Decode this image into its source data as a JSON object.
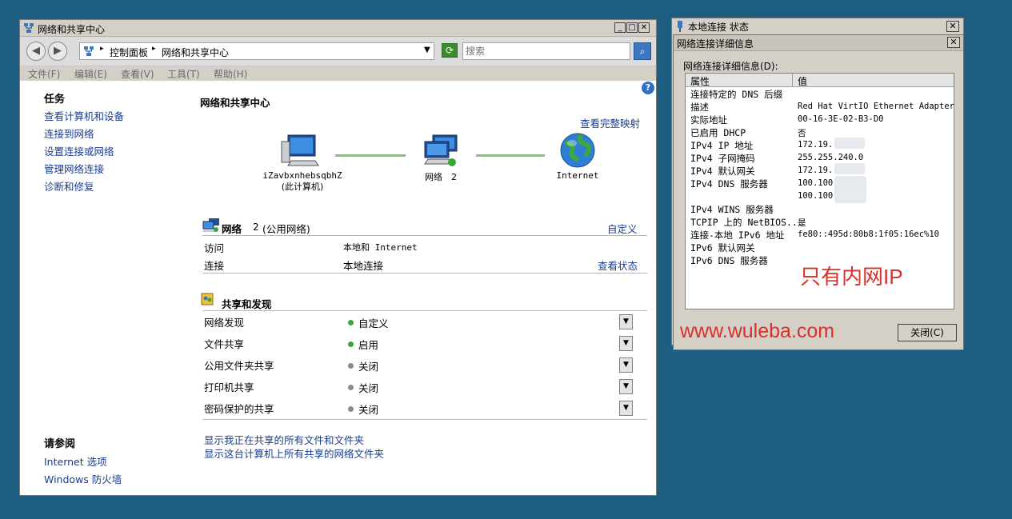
{
  "main_window": {
    "title": "网络和共享中心",
    "breadcrumb": [
      "控制面板",
      "网络和共享中心"
    ],
    "search_placeholder": "搜索",
    "menu": [
      "文件(F)",
      "编辑(E)",
      "查看(V)",
      "工具(T)",
      "帮助(H)"
    ],
    "tasks_title": "任务",
    "tasks": [
      "查看计算机和设备",
      "连接到网络",
      "设置连接或网络",
      "管理网络连接",
      "诊断和修复"
    ],
    "see_also_title": "请参阅",
    "see_also": [
      "Internet 选项",
      "Windows 防火墙"
    ],
    "heading": "网络和共享中心",
    "view_full_map": "查看完整映射",
    "map": {
      "computer_name": "iZavbxnhebsqbhZ",
      "computer_sub": "(此计算机)",
      "network": "网络　2",
      "internet": "Internet"
    },
    "network_section": {
      "name": "网络",
      "number": "2",
      "type": "(公用网络)",
      "customize": "自定义",
      "rows": [
        {
          "label": "访问",
          "value": "本地和 Internet",
          "action": ""
        },
        {
          "label": "连接",
          "value": "本地连接",
          "action": "查看状态"
        }
      ]
    },
    "sharing_section": {
      "title": "共享和发现",
      "rows": [
        {
          "label": "网络发现",
          "value": "自定义",
          "status": "on"
        },
        {
          "label": "文件共享",
          "value": "启用",
          "status": "on"
        },
        {
          "label": "公用文件夹共享",
          "value": "关闭",
          "status": "off"
        },
        {
          "label": "打印机共享",
          "value": "关闭",
          "status": "off"
        },
        {
          "label": "密码保护的共享",
          "value": "关闭",
          "status": "off"
        }
      ]
    },
    "bottom_links": [
      "显示我正在共享的所有文件和文件夹",
      "显示这台计算机上所有共享的网络文件夹"
    ]
  },
  "status_window": {
    "title": "本地连接 状态"
  },
  "detail_window": {
    "title": "网络连接详细信息",
    "label": "网络连接详细信息(D):",
    "col_property": "属性",
    "col_value": "值",
    "rows": [
      {
        "p": "连接特定的 DNS 后缀",
        "v": ""
      },
      {
        "p": "描述",
        "v": "Red Hat VirtIO Ethernet Adapter"
      },
      {
        "p": "实际地址",
        "v": "00-16-3E-02-B3-D0"
      },
      {
        "p": "已启用 DHCP",
        "v": "否"
      },
      {
        "p": "IPv4 IP 地址",
        "v": "172.19."
      },
      {
        "p": "IPv4 子网掩码",
        "v": "255.255.240.0"
      },
      {
        "p": "IPv4 默认网关",
        "v": "172.19."
      },
      {
        "p": "IPv4 DNS 服务器",
        "v": "100.100."
      },
      {
        "p": "",
        "v": "100.100."
      },
      {
        "p": "IPv4 WINS 服务器",
        "v": ""
      },
      {
        "p": "TCPIP 上的 NetBIOS...",
        "v": "是"
      },
      {
        "p": "连接-本地 IPv6 地址",
        "v": "fe80::495d:80b8:1f05:16ec%10"
      },
      {
        "p": "IPv6 默认网关",
        "v": ""
      },
      {
        "p": "IPv6 DNS 服务器",
        "v": ""
      }
    ],
    "annotation": "只有内网IP",
    "watermark": "www.wuleba.com",
    "close_button": "关闭(C)"
  },
  "colors": {
    "desktop": "#1d5e80",
    "link": "#1a3c8c",
    "annotation": "#d9302a",
    "status_on": "#3aa63a",
    "status_off": "#8a8a8a"
  }
}
